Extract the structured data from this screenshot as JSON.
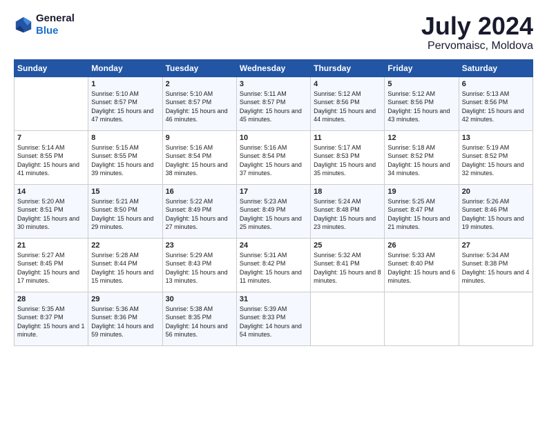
{
  "header": {
    "logo_general": "General",
    "logo_blue": "Blue",
    "title": "July 2024",
    "subtitle": "Pervomaisc, Moldova"
  },
  "calendar": {
    "columns": [
      "Sunday",
      "Monday",
      "Tuesday",
      "Wednesday",
      "Thursday",
      "Friday",
      "Saturday"
    ],
    "weeks": [
      [
        {
          "day": "",
          "sunrise": "",
          "sunset": "",
          "daylight": ""
        },
        {
          "day": "1",
          "sunrise": "Sunrise: 5:10 AM",
          "sunset": "Sunset: 8:57 PM",
          "daylight": "Daylight: 15 hours and 47 minutes."
        },
        {
          "day": "2",
          "sunrise": "Sunrise: 5:10 AM",
          "sunset": "Sunset: 8:57 PM",
          "daylight": "Daylight: 15 hours and 46 minutes."
        },
        {
          "day": "3",
          "sunrise": "Sunrise: 5:11 AM",
          "sunset": "Sunset: 8:57 PM",
          "daylight": "Daylight: 15 hours and 45 minutes."
        },
        {
          "day": "4",
          "sunrise": "Sunrise: 5:12 AM",
          "sunset": "Sunset: 8:56 PM",
          "daylight": "Daylight: 15 hours and 44 minutes."
        },
        {
          "day": "5",
          "sunrise": "Sunrise: 5:12 AM",
          "sunset": "Sunset: 8:56 PM",
          "daylight": "Daylight: 15 hours and 43 minutes."
        },
        {
          "day": "6",
          "sunrise": "Sunrise: 5:13 AM",
          "sunset": "Sunset: 8:56 PM",
          "daylight": "Daylight: 15 hours and 42 minutes."
        }
      ],
      [
        {
          "day": "7",
          "sunrise": "Sunrise: 5:14 AM",
          "sunset": "Sunset: 8:55 PM",
          "daylight": "Daylight: 15 hours and 41 minutes."
        },
        {
          "day": "8",
          "sunrise": "Sunrise: 5:15 AM",
          "sunset": "Sunset: 8:55 PM",
          "daylight": "Daylight: 15 hours and 39 minutes."
        },
        {
          "day": "9",
          "sunrise": "Sunrise: 5:16 AM",
          "sunset": "Sunset: 8:54 PM",
          "daylight": "Daylight: 15 hours and 38 minutes."
        },
        {
          "day": "10",
          "sunrise": "Sunrise: 5:16 AM",
          "sunset": "Sunset: 8:54 PM",
          "daylight": "Daylight: 15 hours and 37 minutes."
        },
        {
          "day": "11",
          "sunrise": "Sunrise: 5:17 AM",
          "sunset": "Sunset: 8:53 PM",
          "daylight": "Daylight: 15 hours and 35 minutes."
        },
        {
          "day": "12",
          "sunrise": "Sunrise: 5:18 AM",
          "sunset": "Sunset: 8:52 PM",
          "daylight": "Daylight: 15 hours and 34 minutes."
        },
        {
          "day": "13",
          "sunrise": "Sunrise: 5:19 AM",
          "sunset": "Sunset: 8:52 PM",
          "daylight": "Daylight: 15 hours and 32 minutes."
        }
      ],
      [
        {
          "day": "14",
          "sunrise": "Sunrise: 5:20 AM",
          "sunset": "Sunset: 8:51 PM",
          "daylight": "Daylight: 15 hours and 30 minutes."
        },
        {
          "day": "15",
          "sunrise": "Sunrise: 5:21 AM",
          "sunset": "Sunset: 8:50 PM",
          "daylight": "Daylight: 15 hours and 29 minutes."
        },
        {
          "day": "16",
          "sunrise": "Sunrise: 5:22 AM",
          "sunset": "Sunset: 8:49 PM",
          "daylight": "Daylight: 15 hours and 27 minutes."
        },
        {
          "day": "17",
          "sunrise": "Sunrise: 5:23 AM",
          "sunset": "Sunset: 8:49 PM",
          "daylight": "Daylight: 15 hours and 25 minutes."
        },
        {
          "day": "18",
          "sunrise": "Sunrise: 5:24 AM",
          "sunset": "Sunset: 8:48 PM",
          "daylight": "Daylight: 15 hours and 23 minutes."
        },
        {
          "day": "19",
          "sunrise": "Sunrise: 5:25 AM",
          "sunset": "Sunset: 8:47 PM",
          "daylight": "Daylight: 15 hours and 21 minutes."
        },
        {
          "day": "20",
          "sunrise": "Sunrise: 5:26 AM",
          "sunset": "Sunset: 8:46 PM",
          "daylight": "Daylight: 15 hours and 19 minutes."
        }
      ],
      [
        {
          "day": "21",
          "sunrise": "Sunrise: 5:27 AM",
          "sunset": "Sunset: 8:45 PM",
          "daylight": "Daylight: 15 hours and 17 minutes."
        },
        {
          "day": "22",
          "sunrise": "Sunrise: 5:28 AM",
          "sunset": "Sunset: 8:44 PM",
          "daylight": "Daylight: 15 hours and 15 minutes."
        },
        {
          "day": "23",
          "sunrise": "Sunrise: 5:29 AM",
          "sunset": "Sunset: 8:43 PM",
          "daylight": "Daylight: 15 hours and 13 minutes."
        },
        {
          "day": "24",
          "sunrise": "Sunrise: 5:31 AM",
          "sunset": "Sunset: 8:42 PM",
          "daylight": "Daylight: 15 hours and 11 minutes."
        },
        {
          "day": "25",
          "sunrise": "Sunrise: 5:32 AM",
          "sunset": "Sunset: 8:41 PM",
          "daylight": "Daylight: 15 hours and 8 minutes."
        },
        {
          "day": "26",
          "sunrise": "Sunrise: 5:33 AM",
          "sunset": "Sunset: 8:40 PM",
          "daylight": "Daylight: 15 hours and 6 minutes."
        },
        {
          "day": "27",
          "sunrise": "Sunrise: 5:34 AM",
          "sunset": "Sunset: 8:38 PM",
          "daylight": "Daylight: 15 hours and 4 minutes."
        }
      ],
      [
        {
          "day": "28",
          "sunrise": "Sunrise: 5:35 AM",
          "sunset": "Sunset: 8:37 PM",
          "daylight": "Daylight: 15 hours and 1 minute."
        },
        {
          "day": "29",
          "sunrise": "Sunrise: 5:36 AM",
          "sunset": "Sunset: 8:36 PM",
          "daylight": "Daylight: 14 hours and 59 minutes."
        },
        {
          "day": "30",
          "sunrise": "Sunrise: 5:38 AM",
          "sunset": "Sunset: 8:35 PM",
          "daylight": "Daylight: 14 hours and 56 minutes."
        },
        {
          "day": "31",
          "sunrise": "Sunrise: 5:39 AM",
          "sunset": "Sunset: 8:33 PM",
          "daylight": "Daylight: 14 hours and 54 minutes."
        },
        {
          "day": "",
          "sunrise": "",
          "sunset": "",
          "daylight": ""
        },
        {
          "day": "",
          "sunrise": "",
          "sunset": "",
          "daylight": ""
        },
        {
          "day": "",
          "sunrise": "",
          "sunset": "",
          "daylight": ""
        }
      ]
    ]
  }
}
